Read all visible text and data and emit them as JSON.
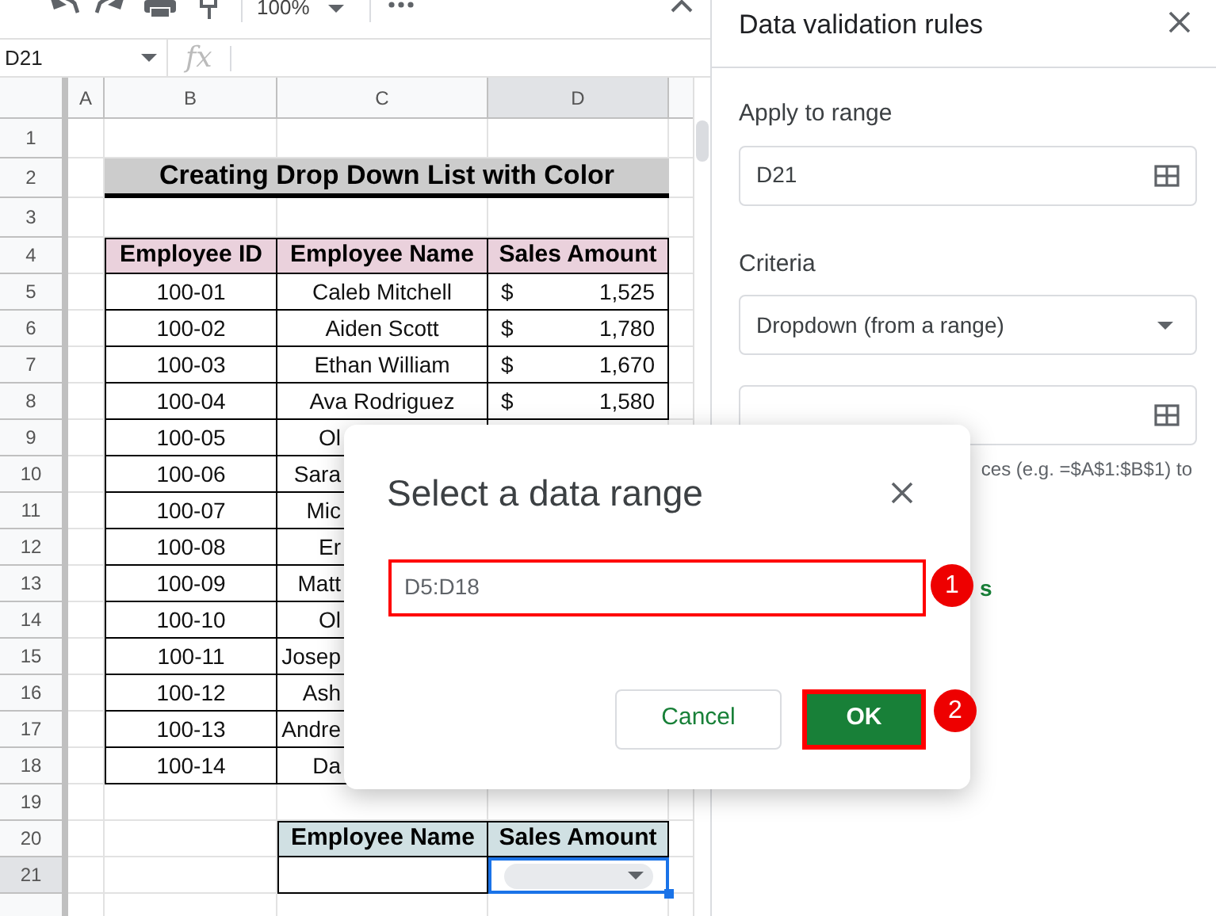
{
  "toolbar": {
    "zoom": "100%"
  },
  "name_box": "D21",
  "formula_icon": "fx",
  "columns": [
    {
      "label": "A",
      "selected": false
    },
    {
      "label": "B",
      "selected": false
    },
    {
      "label": "C",
      "selected": false
    },
    {
      "label": "D",
      "selected": true
    }
  ],
  "row_headers": [
    {
      "label": "1",
      "selected": false
    },
    {
      "label": "2",
      "selected": false
    },
    {
      "label": "3",
      "selected": false
    },
    {
      "label": "4",
      "selected": false
    },
    {
      "label": "5",
      "selected": false
    },
    {
      "label": "6",
      "selected": false
    },
    {
      "label": "7",
      "selected": false
    },
    {
      "label": "8",
      "selected": false
    },
    {
      "label": "9",
      "selected": false
    },
    {
      "label": "10",
      "selected": false
    },
    {
      "label": "11",
      "selected": false
    },
    {
      "label": "12",
      "selected": false
    },
    {
      "label": "13",
      "selected": false
    },
    {
      "label": "14",
      "selected": false
    },
    {
      "label": "15",
      "selected": false
    },
    {
      "label": "16",
      "selected": false
    },
    {
      "label": "17",
      "selected": false
    },
    {
      "label": "18",
      "selected": false
    },
    {
      "label": "19",
      "selected": false
    },
    {
      "label": "20",
      "selected": false
    },
    {
      "label": "21",
      "selected": true
    }
  ],
  "sheet_title": "Creating Drop Down List with Color",
  "table": {
    "columns": [
      "Employee ID",
      "Employee Name",
      "Sales Amount"
    ],
    "rows": [
      {
        "id": "100-01",
        "name": "Caleb Mitchell",
        "currency": "$",
        "amount": "1,525"
      },
      {
        "id": "100-02",
        "name": "Aiden Scott",
        "currency": "$",
        "amount": "1,780"
      },
      {
        "id": "100-03",
        "name": "Ethan William",
        "currency": "$",
        "amount": "1,670"
      },
      {
        "id": "100-04",
        "name": "Ava Rodriguez",
        "currency": "$",
        "amount": "1,580"
      },
      {
        "id": "100-05",
        "name": "Ol"
      },
      {
        "id": "100-06",
        "name": "Sara"
      },
      {
        "id": "100-07",
        "name": "Mic"
      },
      {
        "id": "100-08",
        "name": "Er"
      },
      {
        "id": "100-09",
        "name": "Matt"
      },
      {
        "id": "100-10",
        "name": "Ol"
      },
      {
        "id": "100-11",
        "name": "Josep"
      },
      {
        "id": "100-12",
        "name": "Ash"
      },
      {
        "id": "100-13",
        "name": "Andre"
      },
      {
        "id": "100-14",
        "name": "Da"
      }
    ]
  },
  "lookup": {
    "columns": [
      "Employee Name",
      "Sales Amount"
    ]
  },
  "sidebar": {
    "title": "Data validation rules",
    "apply_label": "Apply to range",
    "apply_value": "D21",
    "criteria_label": "Criteria",
    "criteria_value": "Dropdown (from a range)",
    "hint": "ces (e.g. =$A$1:$B$1) to",
    "link": "s"
  },
  "dialog": {
    "title": "Select a data range",
    "value": "D5:D18",
    "field_highlighted": true,
    "buttons": [
      {
        "label": "Cancel",
        "kind": "secondary",
        "highlighted": false
      },
      {
        "label": "OK",
        "kind": "primary",
        "highlighted": true
      }
    ]
  },
  "annotations": [
    {
      "label": "1"
    },
    {
      "label": "2"
    }
  ]
}
